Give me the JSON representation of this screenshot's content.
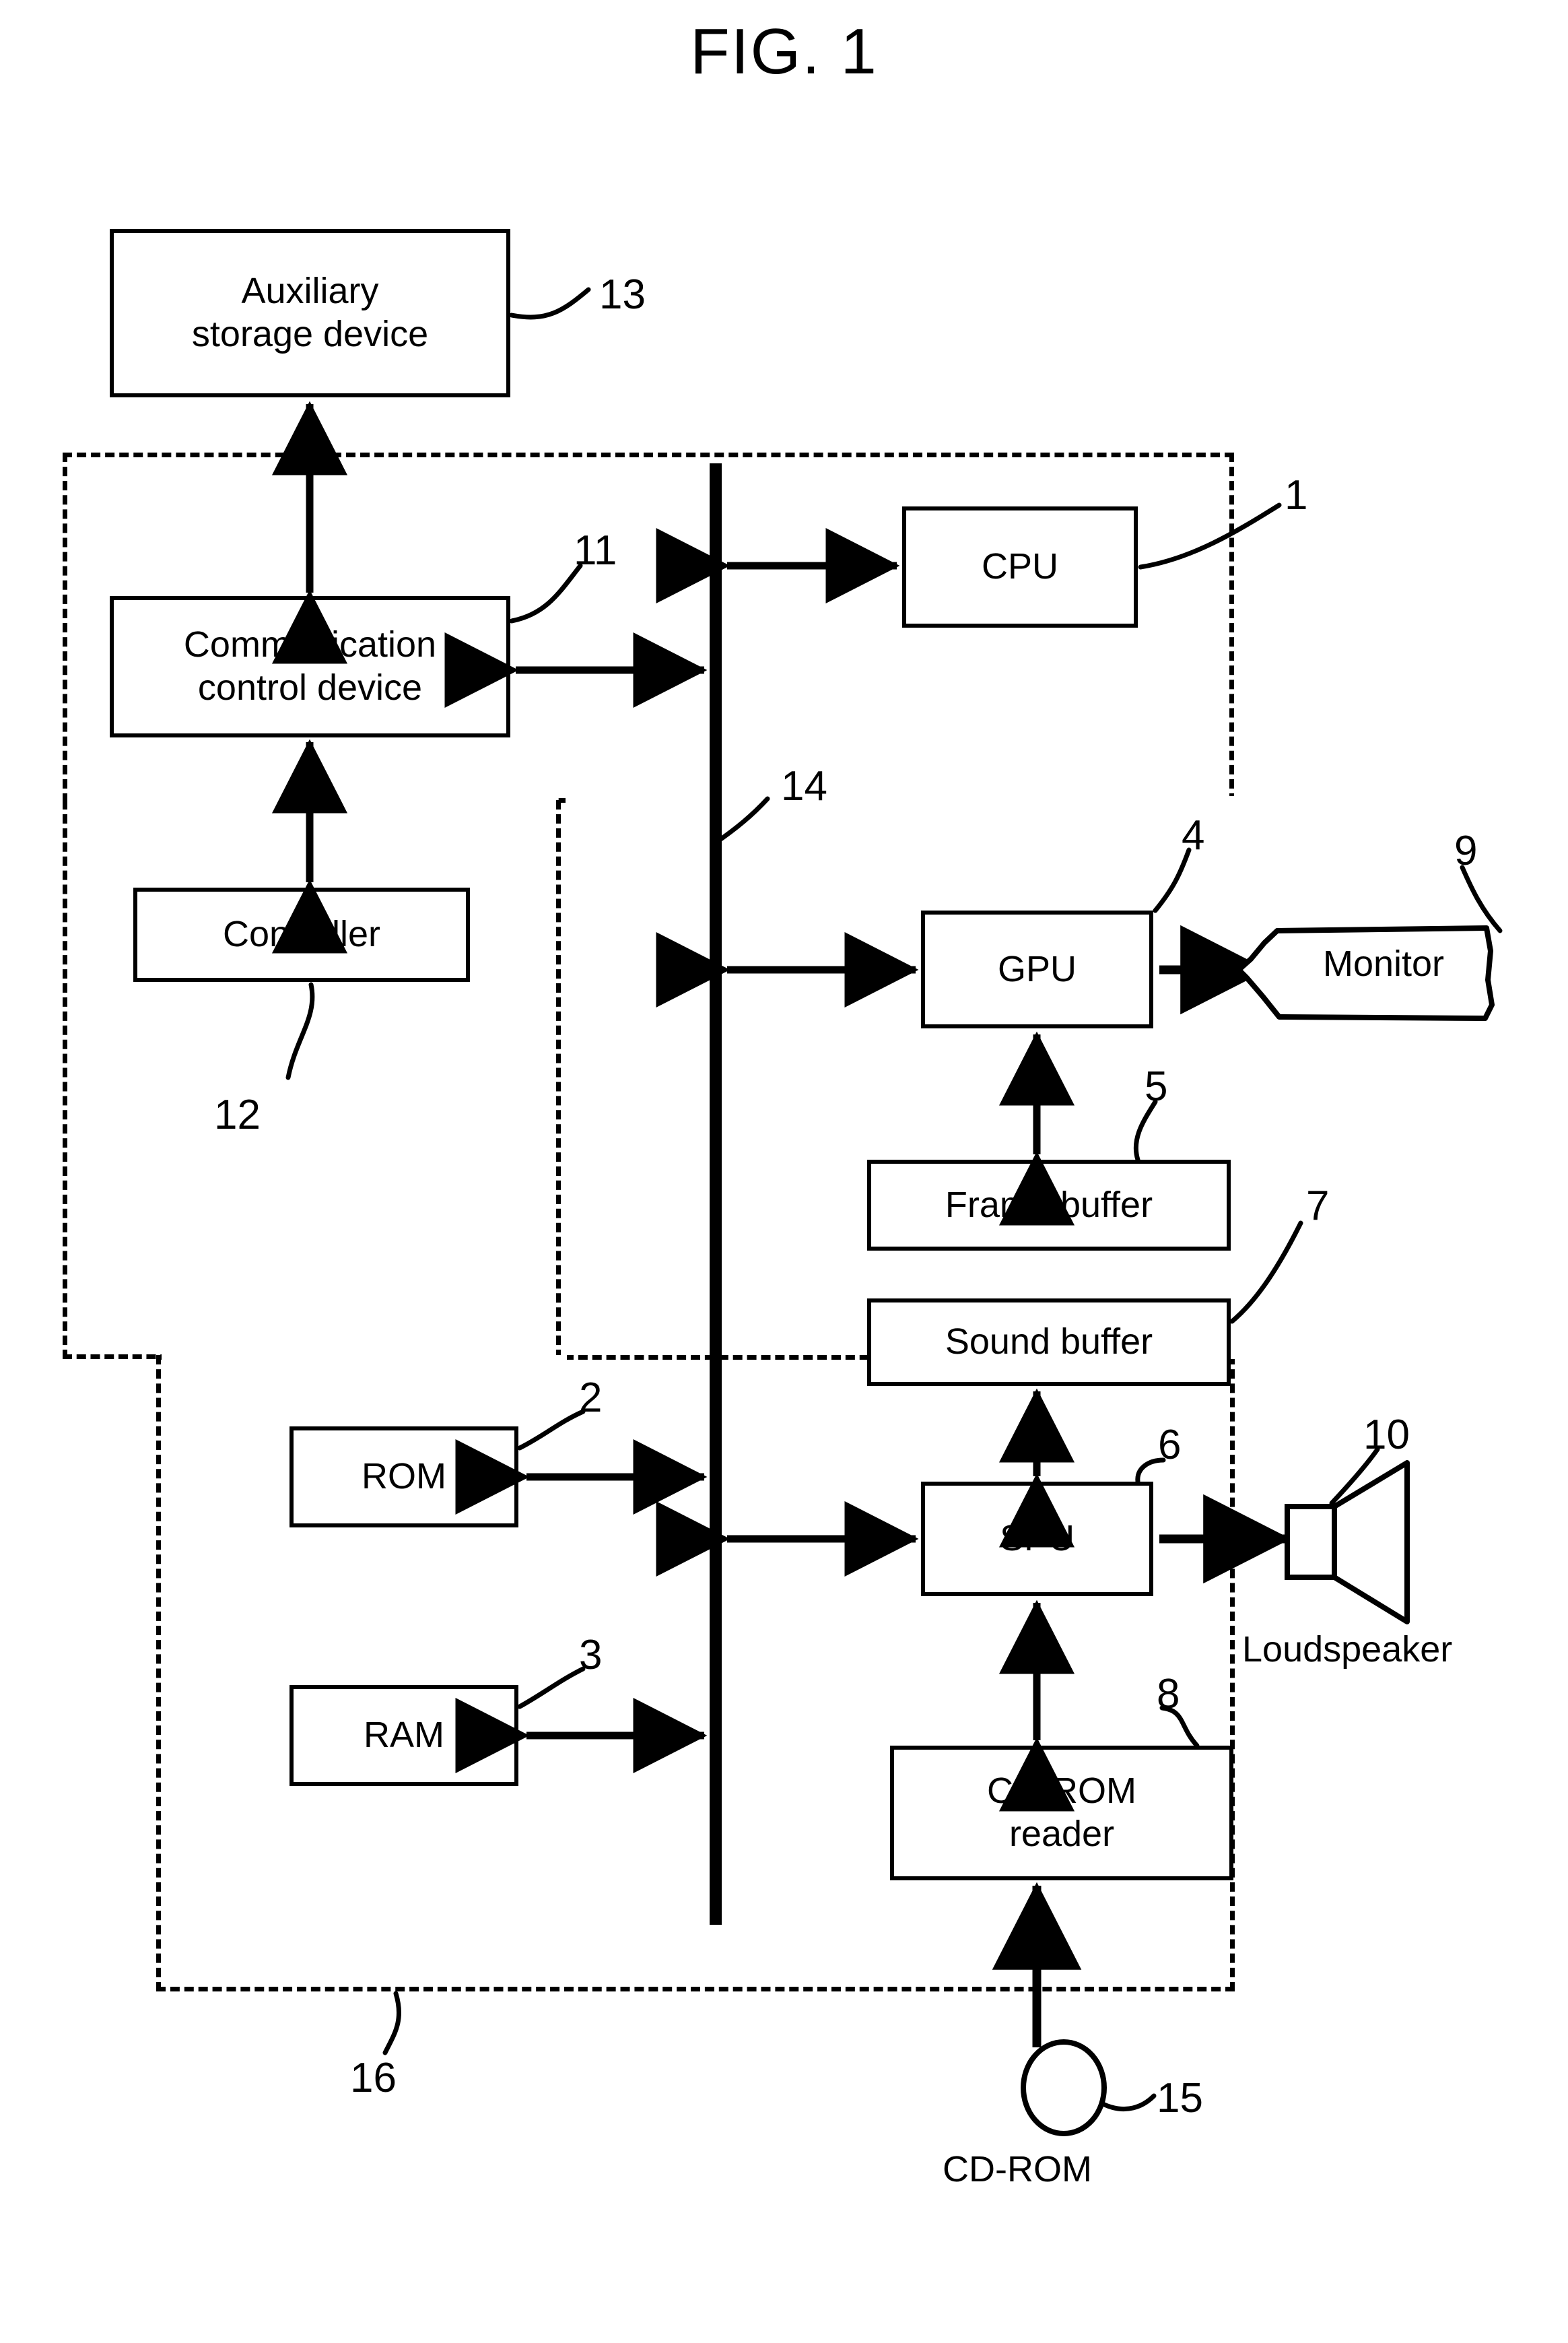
{
  "figure": {
    "title": "FIG. 1"
  },
  "blocks": {
    "auxiliary_storage": {
      "line1": "Auxiliary",
      "line2": "storage device",
      "ref": "13"
    },
    "communication_control": {
      "line1": "Communication",
      "line2": "control device",
      "ref": "11"
    },
    "controller": {
      "line1": "Controller",
      "ref": "12"
    },
    "cpu": {
      "line1": "CPU",
      "ref": "1"
    },
    "gpu": {
      "line1": "GPU",
      "ref": "4"
    },
    "monitor": {
      "line1": "Monitor",
      "ref": "9"
    },
    "frame_buffer": {
      "line1": "Frame buffer",
      "ref": "5"
    },
    "sound_buffer": {
      "line1": "Sound buffer",
      "ref": "7"
    },
    "spu": {
      "line1": "SPU",
      "ref": "6"
    },
    "loudspeaker": {
      "label": "Loudspeaker",
      "ref": "10"
    },
    "rom": {
      "line1": "ROM",
      "ref": "2"
    },
    "ram": {
      "line1": "RAM",
      "ref": "3"
    },
    "cdrom_reader": {
      "line1": "CD-ROM",
      "line2": "reader",
      "ref": "8"
    },
    "cdrom_disc": {
      "label": "CD-ROM",
      "ref": "15"
    },
    "bus": {
      "ref": "14"
    },
    "main_unit": {
      "ref": "16"
    }
  },
  "colors": {
    "stroke": "#000000",
    "background": "#ffffff"
  }
}
